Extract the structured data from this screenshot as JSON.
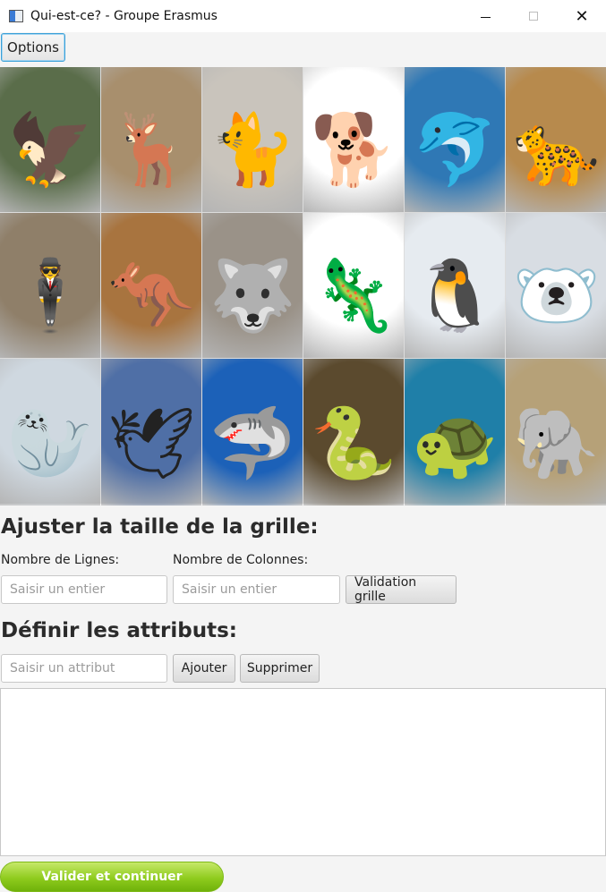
{
  "window": {
    "title": "Qui-est-ce? - Groupe Erasmus",
    "controls": {
      "minimize": "minimize-icon",
      "maximize": "maximize-icon",
      "close": "close-icon"
    }
  },
  "menu": {
    "options_label": "Options"
  },
  "grid": {
    "cards": [
      {
        "name": "eagle",
        "glyph": "🦅",
        "bg": "#5a6d4a"
      },
      {
        "name": "deer",
        "glyph": "🦌",
        "bg": "#a88f6d"
      },
      {
        "name": "cat",
        "glyph": "🐈",
        "bg": "#c9c4bc"
      },
      {
        "name": "dog",
        "glyph": "🐕",
        "bg": "#ffffff"
      },
      {
        "name": "dolphin",
        "glyph": "🐬",
        "bg": "#2f78b5"
      },
      {
        "name": "cheetah",
        "glyph": "🐆",
        "bg": "#b78a4d"
      },
      {
        "name": "man-in-suit",
        "glyph": "🕴",
        "bg": "#8f7f69"
      },
      {
        "name": "kangaroo",
        "glyph": "🦘",
        "bg": "#a8743f"
      },
      {
        "name": "wolf",
        "glyph": "🐺",
        "bg": "#9a9288"
      },
      {
        "name": "lizard",
        "glyph": "🦎",
        "bg": "#ffffff"
      },
      {
        "name": "penguin",
        "glyph": "🐧",
        "bg": "#e6ebf0"
      },
      {
        "name": "polar-bear",
        "glyph": "🐻‍❄️",
        "bg": "#d8dde3"
      },
      {
        "name": "seal",
        "glyph": "🦭",
        "bg": "#cfd8e0"
      },
      {
        "name": "pigeon",
        "glyph": "🕊",
        "bg": "#4f6fa6"
      },
      {
        "name": "shark",
        "glyph": "🦈",
        "bg": "#1c61b8"
      },
      {
        "name": "snake",
        "glyph": "🐍",
        "bg": "#5b4a2e"
      },
      {
        "name": "sea-turtle",
        "glyph": "🐢",
        "bg": "#1f7fa8"
      },
      {
        "name": "elephant",
        "glyph": "🐘",
        "bg": "#b6a178"
      }
    ]
  },
  "grid_size": {
    "heading": "Ajuster la taille de la grille:",
    "rows_label": "Nombre de Lignes:",
    "cols_label": "Nombre de Colonnes:",
    "rows_placeholder": "Saisir un entier",
    "cols_placeholder": "Saisir un entier",
    "validate_label": "Validation grille"
  },
  "attributes": {
    "heading": "Définir les attributs:",
    "input_placeholder": "Saisir un attribut",
    "add_label": "Ajouter",
    "remove_label": "Supprimer",
    "list_value": ""
  },
  "footer": {
    "continue_label": "Valider et continuer"
  }
}
